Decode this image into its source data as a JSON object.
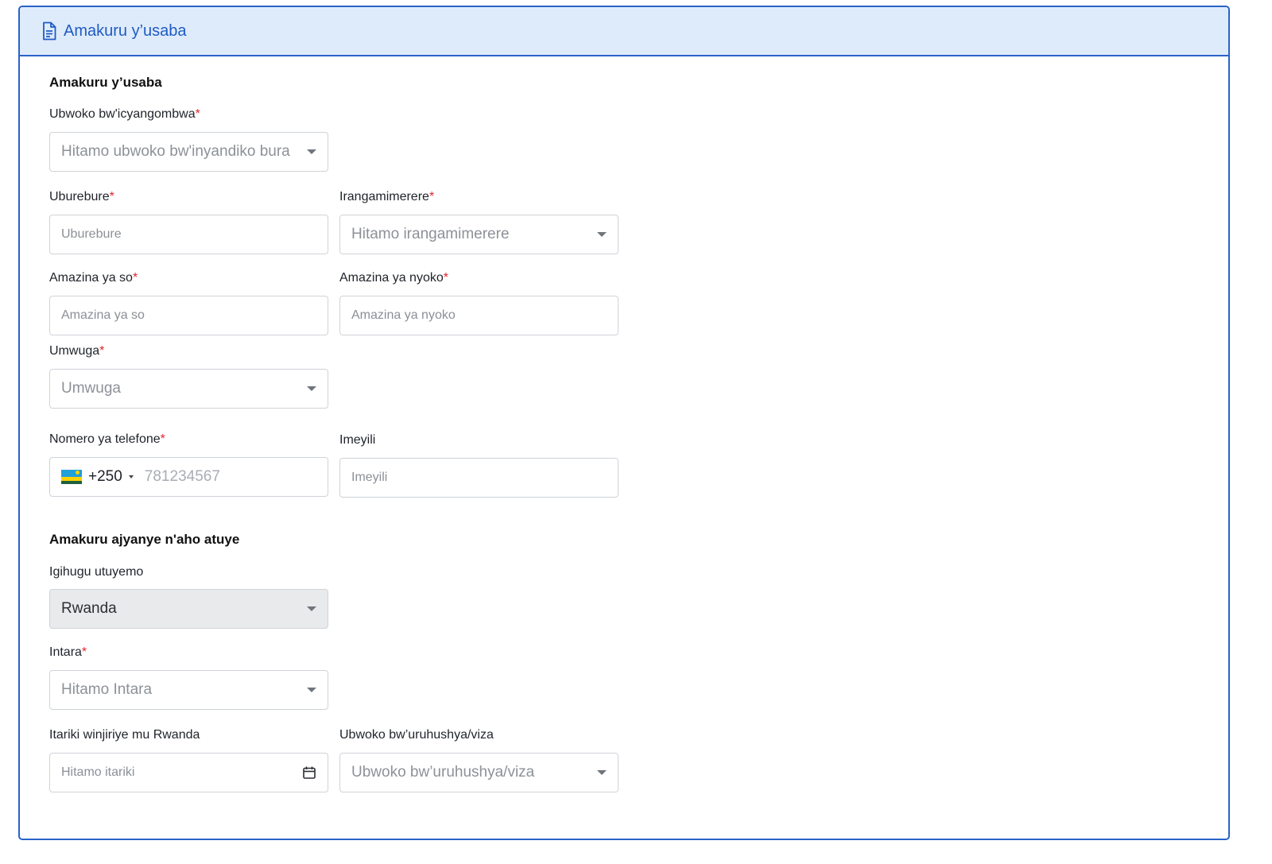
{
  "header": {
    "title": "Amakuru y’usaba",
    "icon": "document-icon"
  },
  "sections": {
    "applicant_title": "Amakuru y’usaba",
    "address_title": "Amakuru ajyanye n'aho atuye"
  },
  "required_marker": "*",
  "fields": {
    "permit_type": {
      "label": "Ubwoko bw'icyangombwa",
      "placeholder": "Hitamo ubwoko bw'inyandiko bura"
    },
    "gender": {
      "label": "Uburebure",
      "placeholder": "Uburebure"
    },
    "marital_status": {
      "label": "Irangamimerere",
      "placeholder": "Hitamo irangamimerere"
    },
    "father_name": {
      "label": "Amazina ya so",
      "placeholder": "Amazina ya so"
    },
    "mother_name": {
      "label": "Amazina ya nyoko",
      "placeholder": "Amazina ya nyoko"
    },
    "profession": {
      "label": "Umwuga",
      "placeholder": "Umwuga"
    },
    "phone": {
      "label": "Nomero ya telefone",
      "country_code": "+250",
      "placeholder": "781234567"
    },
    "email": {
      "label": "Imeyili",
      "placeholder": "Imeyili"
    },
    "country": {
      "label": "Igihugu utuyemo",
      "value": "Rwanda"
    },
    "province": {
      "label": "Intara",
      "placeholder": "Hitamo Intara"
    },
    "arrival_date": {
      "label": "Itariki winjiriye mu Rwanda",
      "placeholder": "Hitamo itariki"
    },
    "visa_type": {
      "label": "Ubwoko bw’uruhushya/viza",
      "placeholder": "Ubwoko bw’uruhushya/viza"
    }
  },
  "colors": {
    "accent": "#2a62c9",
    "header_bg": "#deebfa",
    "required": "#e5232f"
  }
}
